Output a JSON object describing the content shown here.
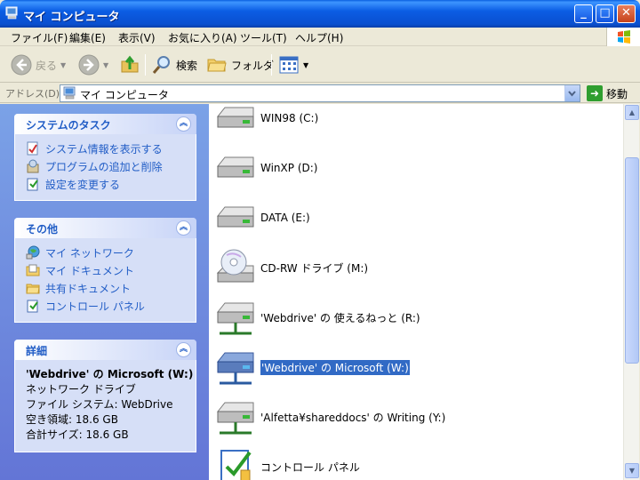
{
  "window": {
    "title": "マイ コンピュータ"
  },
  "menu": [
    "ファイル(F)",
    "編集(E)",
    "表示(V)",
    "お気に入り(A)",
    "ツール(T)",
    "ヘルプ(H)"
  ],
  "toolbar": {
    "back": "戻る",
    "search": "検索",
    "folders": "フォルダ"
  },
  "address": {
    "label": "アドレス(D)",
    "value": "マイ コンピュータ",
    "go": "移動"
  },
  "panels": {
    "system_tasks": {
      "title": "システムのタスク",
      "items": [
        "システム情報を表示する",
        "プログラムの追加と削除",
        "設定を変更する"
      ]
    },
    "other": {
      "title": "その他",
      "items": [
        "マイ ネットワーク",
        "マイ ドキュメント",
        "共有ドキュメント",
        "コントロール パネル"
      ]
    },
    "details": {
      "title": "詳細",
      "name": "'Webdrive' の Microsoft (W:)",
      "type": "ネットワーク ドライブ",
      "filesystem": "ファイル システム: WebDrive",
      "free": "空き領域: 18.6 GB",
      "total": "合計サイズ: 18.6 GB"
    }
  },
  "drives": [
    {
      "label": "WIN98 (C:)",
      "icon": "hard-disk-icon"
    },
    {
      "label": "WinXP (D:)",
      "icon": "hard-disk-icon"
    },
    {
      "label": "DATA (E:)",
      "icon": "hard-disk-icon"
    },
    {
      "label": "CD-RW ドライブ (M:)",
      "icon": "cd-drive-icon"
    },
    {
      "label": "'Webdrive' の 使えるねっと (R:)",
      "icon": "network-drive-icon"
    },
    {
      "label": "'Webdrive' の Microsoft (W:)",
      "icon": "network-drive-icon"
    },
    {
      "label": "'Alfetta¥shareddocs' の Writing (Y:)",
      "icon": "network-drive-icon"
    },
    {
      "label": "コントロール パネル",
      "icon": "control-panel-icon"
    }
  ],
  "colors": {
    "accent": "#215dc6",
    "selection": "#316ac5",
    "titlebar": "#0a5fe0"
  }
}
